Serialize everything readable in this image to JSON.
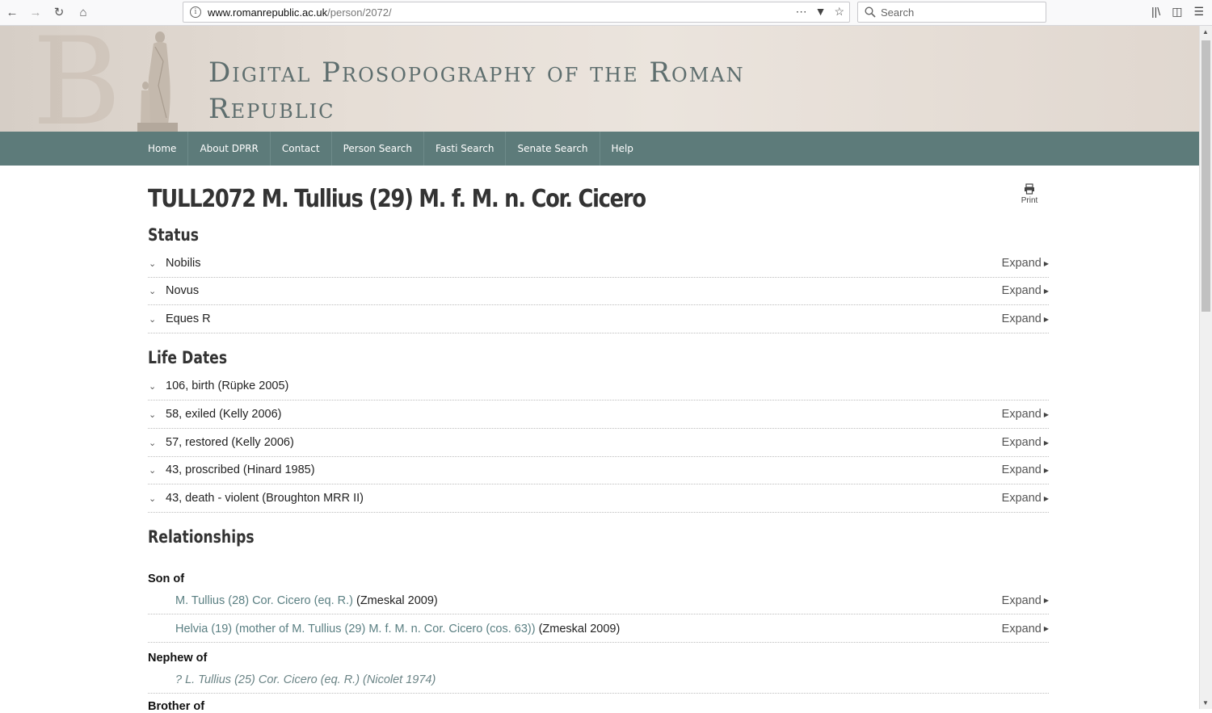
{
  "browser": {
    "url_host": "www.romanrepublic.ac.uk",
    "url_path": "/person/2072/",
    "search_placeholder": "Search"
  },
  "site": {
    "title_line1": "Digital Prosopography of the Roman",
    "title_line2": "Republic"
  },
  "nav": [
    "Home",
    "About DPRR",
    "Contact",
    "Person Search",
    "Fasti Search",
    "Senate Search",
    "Help"
  ],
  "page": {
    "title": "TULL2072 M. Tullius (29) M. f. M. n. Cor. Cicero",
    "print_label": "Print"
  },
  "expand_label": "Expand",
  "status": {
    "heading": "Status",
    "items": [
      "Nobilis",
      "Novus",
      "Eques R"
    ]
  },
  "life_dates": {
    "heading": "Life Dates",
    "items": [
      {
        "label": "106, birth (Rüpke 2005)",
        "expand": false
      },
      {
        "label": "58, exiled (Kelly 2006)",
        "expand": true
      },
      {
        "label": "57, restored (Kelly 2006)",
        "expand": true
      },
      {
        "label": "43, proscribed (Hinard 1985)",
        "expand": true
      },
      {
        "label": "43, death - violent (Broughton MRR II)",
        "expand": true
      }
    ]
  },
  "relationships": {
    "heading": "Relationships",
    "son_of": {
      "label": "Son of",
      "items": [
        {
          "link": "M. Tullius (28) Cor. Cicero (eq. R.)",
          "cite": "(Zmeskal 2009)"
        },
        {
          "link": "Helvia (19) (mother of M. Tullius (29) M. f. M. n. Cor. Cicero (cos. 63))",
          "cite": "(Zmeskal 2009)"
        }
      ]
    },
    "nephew_of": {
      "label": "Nephew of",
      "items": [
        {
          "link": "? L. Tullius (25) Cor. Cicero (eq. R.)",
          "cite": "(Nicolet 1974)"
        }
      ]
    },
    "brother_of": {
      "label": "Brother of"
    }
  }
}
